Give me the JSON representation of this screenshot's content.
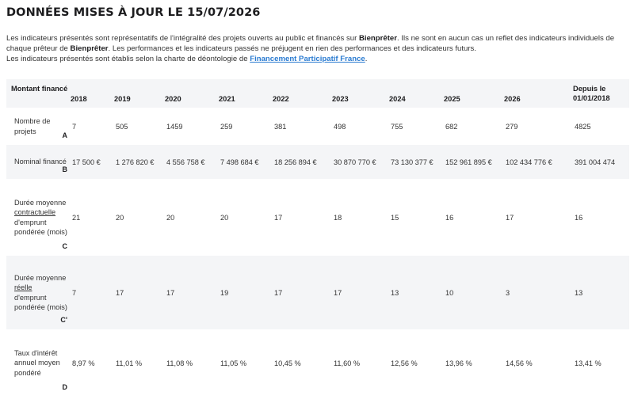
{
  "heading": "DONNÉES MISES À JOUR LE 15/07/2026",
  "intro": {
    "p1_a": "Les indicateurs présentés sont représentatifs de l'intégralité des projets ouverts au public et financés sur ",
    "p1_brand1": "Bienprêter",
    "p1_b": ". Ils ne sont en aucun cas un reflet des indicateurs individuels de chaque prêteur de ",
    "p1_brand2": "Bienprêter",
    "p1_c": ". Les performances et les indicateurs passés ne préjugent en rien des performances et des indicateurs futurs.",
    "p2_a": "Les indicateurs présentés sont établis selon la charte de déontologie de ",
    "p2_link": "Financement Participatif France",
    "p2_b": "."
  },
  "table": {
    "header_first": "Montant financé",
    "years": [
      "2018",
      "2019",
      "2020",
      "2021",
      "2022",
      "2023",
      "2024",
      "2025",
      "2026"
    ],
    "since": "Depuis le 01/01/2018",
    "rows": [
      {
        "label_a": "Nombre de projets",
        "label_u": "",
        "label_b": "",
        "letter": "A",
        "values": [
          "7",
          "505",
          "1459",
          "259",
          "381",
          "498",
          "755",
          "682",
          "279",
          "4825"
        ]
      },
      {
        "label_a": "Nominal financé",
        "label_u": "",
        "label_b": "",
        "letter": "B",
        "values": [
          "17 500 €",
          "1 276 820 €",
          "4 556 758 €",
          "7 498 684 €",
          "18 256 894 €",
          "30 870 770 €",
          "73 130 377 €",
          "152 961 895 €",
          "102 434 776 €",
          "391 004 474"
        ]
      },
      {
        "label_a": "Durée moyenne",
        "label_u": "contractuelle",
        "label_b": "d'emprunt pondérée (mois)",
        "letter": "C",
        "values": [
          "21",
          "20",
          "20",
          "20",
          "17",
          "18",
          "15",
          "16",
          "17",
          "16"
        ]
      },
      {
        "label_a": "Durée moyenne",
        "label_u": "réelle",
        "label_b": "d'emprunt pondérée (mois)",
        "letter": "C'",
        "values": [
          "7",
          "17",
          "17",
          "19",
          "17",
          "17",
          "13",
          "10",
          "3",
          "13"
        ]
      },
      {
        "label_a": "Taux d'intérêt annuel moyen pondéré",
        "label_u": "",
        "label_b": "",
        "letter": "D",
        "values": [
          "8,97 %",
          "11,01 %",
          "11,08 %",
          "11,05 %",
          "10,45 %",
          "11,60 %",
          "12,56 %",
          "13,96 %",
          "14,56 %",
          "13,41 %"
        ]
      }
    ]
  },
  "colors": {
    "link": "#2a7bd1",
    "row_alt": "#f4f5f7"
  }
}
